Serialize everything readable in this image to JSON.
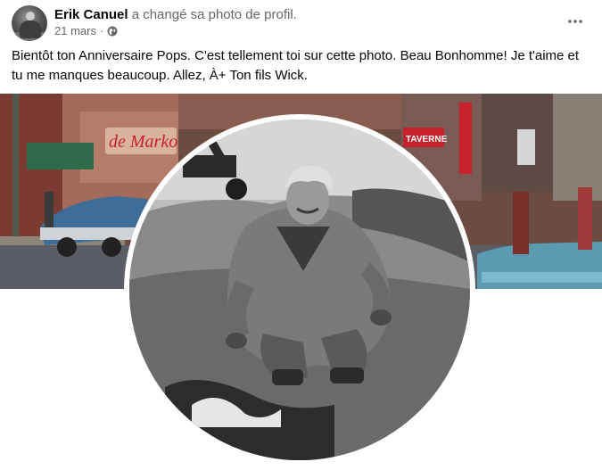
{
  "post": {
    "author": "Erik Canuel",
    "action": "a changé sa photo de profil.",
    "date": "21 mars",
    "separator": "·",
    "audience_icon": "globe-icon",
    "more_icon": "more-options-icon",
    "message": "Bientôt ton Anniversaire Pops. C'est tellement toi sur cette photo. Beau Bonhomme!  Je t'aime et tu me manques beaucoup. Allez, À+ Ton fils Wick."
  },
  "cover_signs": {
    "left_sign": "de Marko",
    "right_sign": "TAVERNE"
  },
  "colors": {
    "meta_gray": "#65676b",
    "text": "#050505",
    "taxi_teal": "#5b9ab0",
    "neon_red": "#c8232c"
  }
}
